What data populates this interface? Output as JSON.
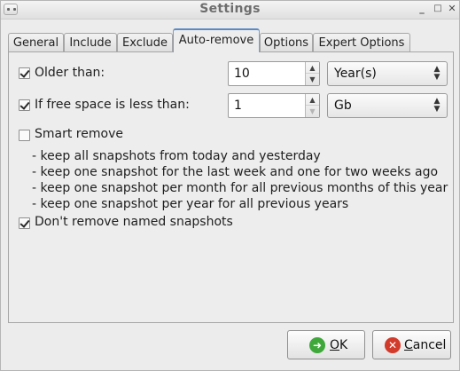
{
  "window": {
    "title": "Settings",
    "controls": {
      "minimize": "_",
      "maximize": "□",
      "close": "✕"
    }
  },
  "tabs": [
    {
      "label": "General",
      "active": false
    },
    {
      "label": "Include",
      "active": false
    },
    {
      "label": "Exclude",
      "active": false
    },
    {
      "label": "Auto-remove",
      "active": true
    },
    {
      "label": "Options",
      "active": false
    },
    {
      "label": "Expert Options",
      "active": false
    }
  ],
  "auto_remove": {
    "older_than": {
      "label": "Older than:",
      "checked": true,
      "value": "10",
      "unit": "Year(s)"
    },
    "free_space": {
      "label": "If free space is less than:",
      "checked": true,
      "value": "1",
      "unit": "Gb"
    },
    "smart_remove": {
      "label": "Smart remove",
      "checked": false,
      "rules": [
        "- keep all snapshots from today and yesterday",
        "- keep one snapshot for the last week and one for two weeks ago",
        "- keep one snapshot per month for all previous months of this year",
        "- keep one snapshot per year for all previous years"
      ]
    },
    "named_snapshots": {
      "label": "Don't remove named snapshots",
      "checked": true
    }
  },
  "buttons": {
    "ok": {
      "label_first": "O",
      "label_rest": "K",
      "icon": "ok-arrow-icon",
      "color": "#3ea83a"
    },
    "cancel": {
      "label_first": "C",
      "label_rest": "ancel",
      "icon": "cancel-x-icon",
      "color": "#d23a2a"
    }
  },
  "icons": {
    "window_menu": "window-menu-icon",
    "spin_up": "chevron-up-icon",
    "spin_down": "chevron-down-icon",
    "combo": "updown-chevron-icon"
  },
  "colors": {
    "active_tab_accent": "#5b8bc4",
    "panel_border": "#a6a6a6"
  }
}
